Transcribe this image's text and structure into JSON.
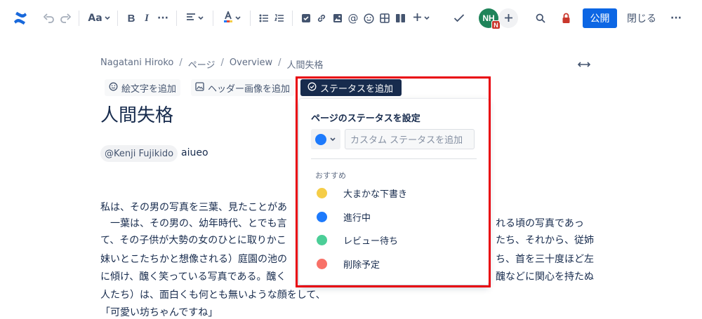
{
  "toolbar": {
    "text_style_label": "Aa",
    "bold_label": "B",
    "italic_label": "I",
    "more_format_label": "···",
    "avatar_initials": "NH",
    "avatar_badge": "N",
    "publish_label": "公開",
    "close_label": "閉じる",
    "brand_color": "#1868db",
    "publish_color": "#0c66e4",
    "restriction_color": "#c9372c"
  },
  "breadcrumb": {
    "items": [
      "Nagatani Hiroko",
      "ページ",
      "Overview",
      "人間失格"
    ],
    "separator": "/"
  },
  "header_actions": {
    "emoji_label": "絵文字を追加",
    "header_image_label": "ヘッダー画像を追加",
    "status_label": "ステータスを追加"
  },
  "page": {
    "title": "人間失格",
    "mention": "@Kenji Fujikido",
    "mention_suffix": "aiueo",
    "body_lines": [
      "私は、その男の写真を三葉、見たことがあ",
      "　一葉は、その男の、幼年時代、とでも言",
      "て、その子供が大勢の女のひとに取りかこ",
      "妹いとこたちかと想像される）庭園の池の",
      "に傾け、醜く笑っている写真である。醜く",
      "人たち）は、面白くも何とも無いような顔をして、",
      "「可愛い坊ちゃんですね」"
    ],
    "right_fragments": [
      "れる頃の写真であっ",
      "たち、それから、従姉",
      "ち、首を三十度ほど左",
      "醜などに関心を持たぬ"
    ]
  },
  "status_popup": {
    "title": "ページのステータスを設定",
    "selected_color": "#1d7afc",
    "input_placeholder": "カスタム ステータスを追加",
    "recommended_label": "おすすめ",
    "options": [
      {
        "label": "大まかな下書き",
        "color": "#f5cd47"
      },
      {
        "label": "進行中",
        "color": "#1d7afc"
      },
      {
        "label": "レビュー待ち",
        "color": "#4bce97"
      },
      {
        "label": "削除予定",
        "color": "#f87168"
      }
    ]
  },
  "highlight_color": "#e8000b"
}
